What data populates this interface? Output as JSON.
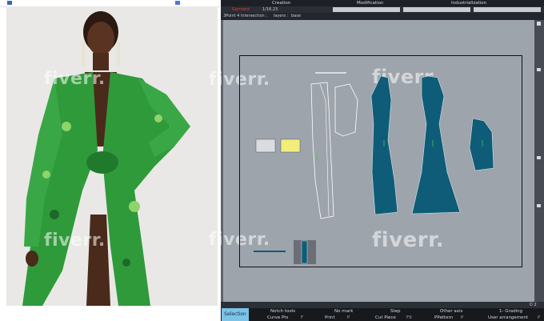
{
  "watermarks": [
    "fiverr.",
    "fiverr.",
    "fiverr.",
    "fiverr.",
    "fiverr.",
    "fiverr."
  ],
  "menubar": {
    "creation": "Creation",
    "modification": "Modification",
    "industrialization": "Industrialization"
  },
  "secondbar": {
    "model_label": "Garment",
    "scale": "1/16.23"
  },
  "pathbar": {
    "tool": "3Point 4 Intersection ;",
    "layers": "layers :",
    "layer_name": "base"
  },
  "bottom_toolbar": {
    "selection": "Selection",
    "row1": [
      "Notch tools",
      "No mark",
      "Step",
      "Other axis",
      "1- Grading"
    ],
    "row2": [
      "Curve Pts",
      "Print",
      "Cut Piece",
      "PPattern",
      "User arrangement"
    ],
    "row2_keys": [
      "F",
      "P",
      "F9",
      "P",
      "P"
    ]
  },
  "scroll_ticks": [
    "D",
    "2"
  ],
  "colors": {
    "canvas": "#9ea4ac",
    "piece_fill": "#0e5c77",
    "toolbar_bg": "#17191d",
    "selection_btn": "#7cc3e8",
    "dress_green": "#2f9a3a"
  }
}
